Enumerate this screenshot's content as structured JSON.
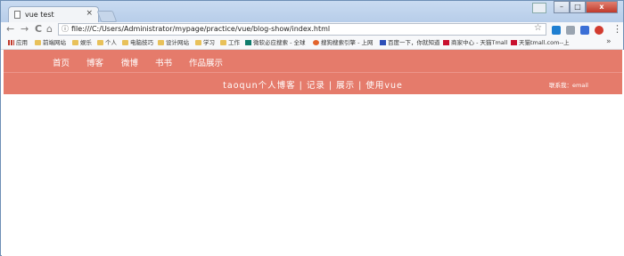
{
  "browser": {
    "tab_title": "vue test",
    "tab_close": "×",
    "url": "file:///C:/Users/Administrator/mypage/practice/vue/blog-show/index.html",
    "window_min": "–",
    "window_max": "□",
    "window_close": "x",
    "back_glyph": "←",
    "forward_glyph": "→",
    "reload_glyph": "C",
    "home_glyph": "⌂",
    "info_glyph": "ⓘ",
    "star_glyph": "☆",
    "menu_glyph": "⋮",
    "bookmarks_more": "»",
    "bookmarks": [
      {
        "label": "应用",
        "icon": "apps-icon"
      },
      {
        "label": "前端网站",
        "icon": "folder-icon"
      },
      {
        "label": "娱乐",
        "icon": "folder-icon"
      },
      {
        "label": "个人",
        "icon": "folder-icon"
      },
      {
        "label": "电脑技巧",
        "icon": "folder-icon"
      },
      {
        "label": "设计网站",
        "icon": "folder-icon"
      },
      {
        "label": "学习",
        "icon": "folder-icon"
      },
      {
        "label": "工作",
        "icon": "folder-icon"
      },
      {
        "label": "微软必应搜索 - 全球",
        "icon": "bing-icon"
      },
      {
        "label": "搜狗搜索引擎 - 上网",
        "icon": "sogou-icon"
      },
      {
        "label": "百度一下，你就知道",
        "icon": "baidu-icon"
      },
      {
        "label": "商家中心 - 天猫Tmall",
        "icon": "tmall-icon"
      },
      {
        "label": "天猫tmall.com--上",
        "icon": "tmall-icon"
      }
    ]
  },
  "page": {
    "nav": [
      "首页",
      "博客",
      "微博",
      "书书",
      "作品展示"
    ],
    "subtitle": "taoqun个人博客 | 记录 | 展示 | 使用vue",
    "contact": "联系我：email"
  },
  "colors": {
    "nav_bg": "#e57b6b",
    "nav_text": "#ffffff"
  }
}
